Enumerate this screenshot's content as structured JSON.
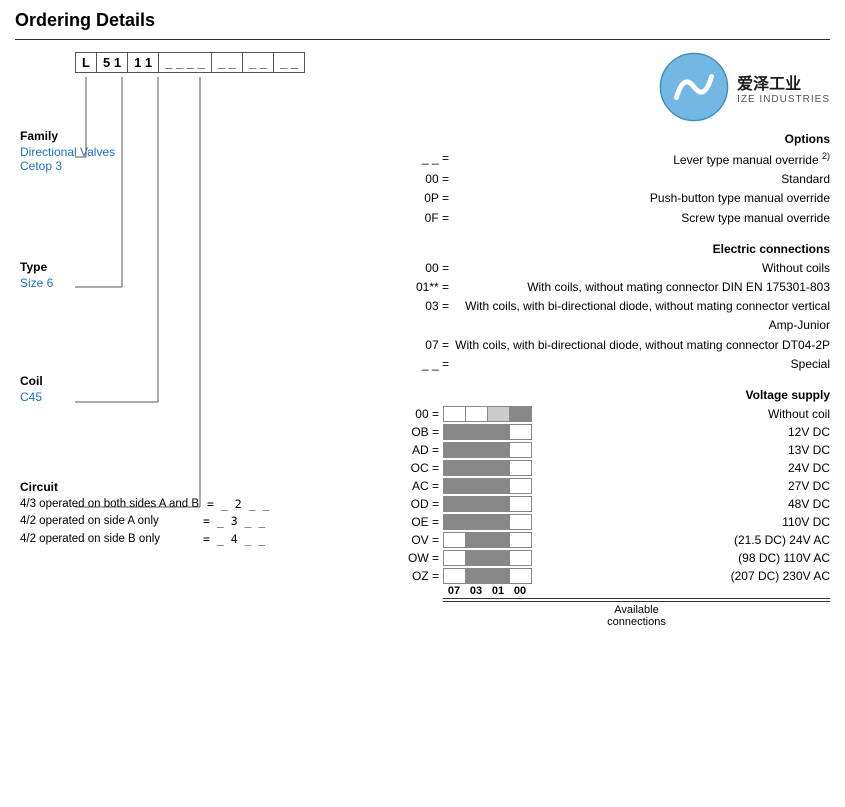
{
  "page": {
    "title": "Ordering Details"
  },
  "code_diagram": {
    "segments": [
      "L",
      "5 1",
      "1 1",
      "_ _ _ _",
      "_ _",
      "_ _",
      "_ _"
    ]
  },
  "family": {
    "title": "Family",
    "values": [
      "Directional Valves",
      "Cetop 3"
    ]
  },
  "type": {
    "title": "Type",
    "value": "Size 6"
  },
  "coil": {
    "title": "Coil",
    "value": "C45"
  },
  "circuit": {
    "title": "Circuit",
    "rows": [
      {
        "desc": "4/3 operated on both sides A and B",
        "code": "= _ 2 _ _"
      },
      {
        "desc": "4/2 operated on side A only",
        "code": "= _ 3 _ _"
      },
      {
        "desc": "4/2 operated on side B only",
        "code": "= _ 4 _ _"
      }
    ]
  },
  "options": {
    "title": "Options",
    "rows": [
      {
        "code": "_ _ =",
        "desc": "Lever type manual override 2)"
      },
      {
        "code": "00 =",
        "desc": "Standard"
      },
      {
        "code": "0P =",
        "desc": "Push-button type manual override"
      },
      {
        "code": "0F =",
        "desc": "Screw type manual override"
      }
    ]
  },
  "electric": {
    "title": "Electric connections",
    "rows": [
      {
        "code": "00 =",
        "desc": "Without coils"
      },
      {
        "code": "01** =",
        "desc": "With coils, without mating connector DIN EN 175301-803"
      },
      {
        "code": "03 =",
        "desc": "With coils, with bi-directional diode, without mating connector vertical Amp-Junior"
      },
      {
        "code": "07 =",
        "desc": "With coils, with bi-directional diode, without mating connector DT04-2P"
      },
      {
        "code": "_ _ =",
        "desc": "Special"
      }
    ]
  },
  "voltage": {
    "title": "Voltage supply",
    "header": [
      "07",
      "03",
      "01",
      "00"
    ],
    "available_label": "Available\nconnections",
    "rows": [
      {
        "code": "00 =",
        "desc": "Without coil",
        "cells": [
          "white",
          "white",
          "light",
          "filled"
        ]
      },
      {
        "code": "OB =",
        "desc": "12V DC",
        "cells": [
          "filled",
          "filled",
          "filled",
          "white"
        ]
      },
      {
        "code": "AD =",
        "desc": "13V DC",
        "cells": [
          "filled",
          "filled",
          "filled",
          "white"
        ]
      },
      {
        "code": "OC =",
        "desc": "24V DC",
        "cells": [
          "filled",
          "filled",
          "filled",
          "white"
        ]
      },
      {
        "code": "AC =",
        "desc": "27V DC",
        "cells": [
          "filled",
          "filled",
          "filled",
          "white"
        ]
      },
      {
        "code": "OD =",
        "desc": "48V DC",
        "cells": [
          "filled",
          "filled",
          "filled",
          "white"
        ]
      },
      {
        "code": "OE =",
        "desc": "110V DC",
        "cells": [
          "filled",
          "filled",
          "filled",
          "white"
        ]
      },
      {
        "code": "OV =",
        "desc": "(21.5 DC) 24V AC",
        "cells": [
          "white",
          "filled",
          "filled",
          "white"
        ]
      },
      {
        "code": "OW =",
        "desc": "(98 DC) 110V AC",
        "cells": [
          "white",
          "filled",
          "filled",
          "white"
        ]
      },
      {
        "code": "OZ =",
        "desc": "(207 DC) 230V AC",
        "cells": [
          "white",
          "filled",
          "filled",
          "white"
        ]
      }
    ]
  },
  "logo": {
    "company_cn": "爱泽工业",
    "company_en": "IZE INDUSTRIES"
  }
}
